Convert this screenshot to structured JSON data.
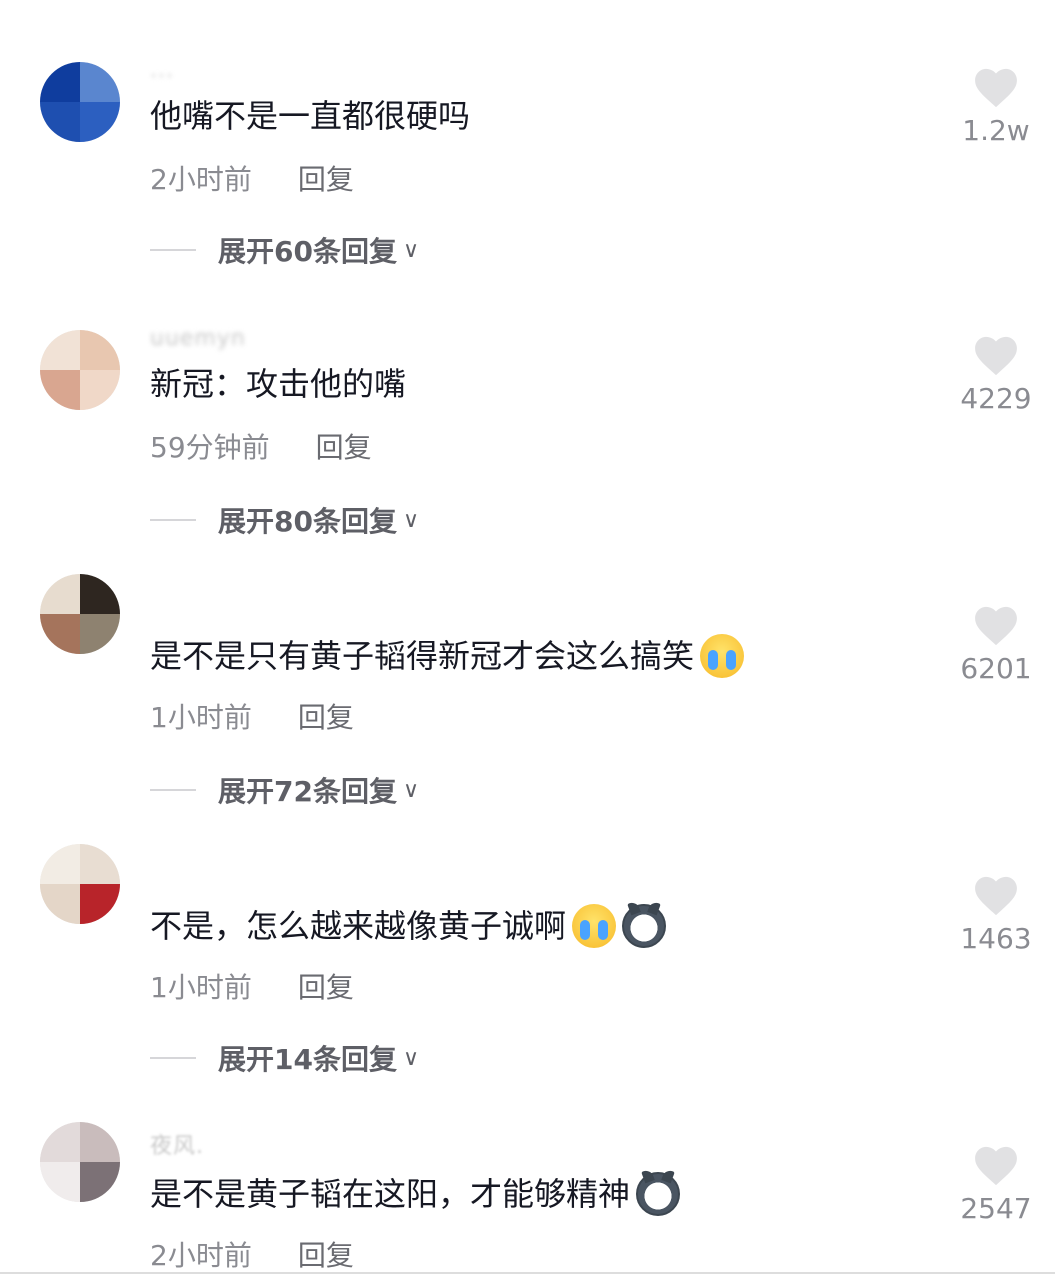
{
  "comments": [
    {
      "username": "...",
      "content": "他嘴不是一直都很硬吗",
      "emojis": [],
      "time": "2小时前",
      "reply_label": "回复",
      "expand_label": "展开60条回复",
      "likes": "1.2w",
      "avatar_colors": [
        "#0f3d9e",
        "#5a86cf",
        "#1e4fb0",
        "#2c5fc0"
      ]
    },
    {
      "username": "uuemyn",
      "content": "新冠：攻击他的嘴",
      "emojis": [],
      "time": "59分钟前",
      "reply_label": "回复",
      "expand_label": "展开80条回复",
      "likes": "4229",
      "avatar_colors": [
        "#f1e2d6",
        "#e8c7b0",
        "#d9a690",
        "#f0d8c8"
      ]
    },
    {
      "username": "",
      "content": "是不是只有黄子韬得新冠才会这么搞笑",
      "emojis": [
        "crying-emoji"
      ],
      "time": "1小时前",
      "reply_label": "回复",
      "expand_label": "展开72条回复",
      "likes": "6201",
      "avatar_colors": [
        "#e7dccf",
        "#2e2620",
        "#a5745c",
        "#8e8270"
      ]
    },
    {
      "username": "",
      "content": "不是，怎么越来越像黄子诚啊",
      "emojis": [
        "teary-emoji",
        "husky-emoji"
      ],
      "time": "1小时前",
      "reply_label": "回复",
      "expand_label": "展开14条回复",
      "likes": "1463",
      "avatar_colors": [
        "#f2ece4",
        "#e8ddd2",
        "#e4d6c8",
        "#b8242a"
      ]
    },
    {
      "username": "夜风.",
      "content": "是不是黄子韬在这阳，才能够精神",
      "emojis": [
        "husky-emoji"
      ],
      "time": "2小时前",
      "reply_label": "回复",
      "expand_label": "",
      "likes": "2547",
      "avatar_colors": [
        "#e2dada",
        "#c9bcbc",
        "#f0ecec",
        "#7c7176"
      ]
    }
  ],
  "colors": {
    "text_primary": "#161823",
    "text_secondary": "#8a8b91",
    "heart": "#e1e1e3"
  }
}
